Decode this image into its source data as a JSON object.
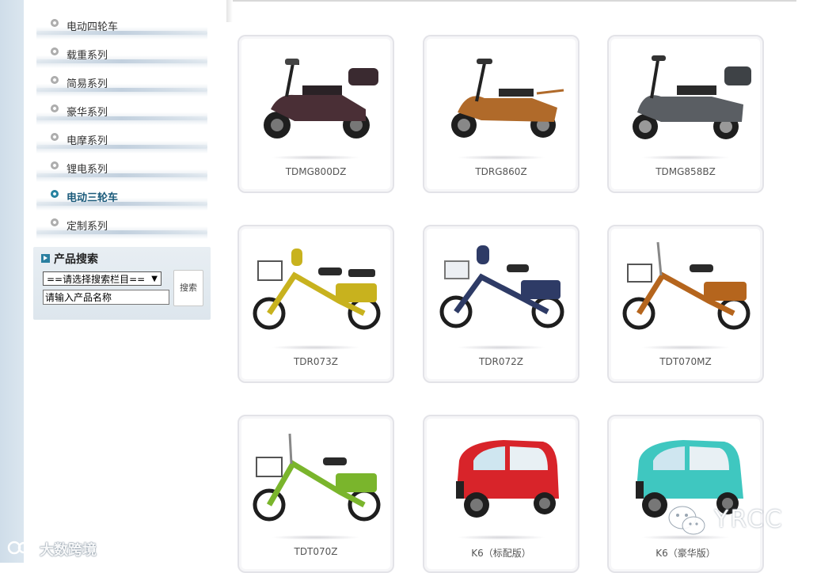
{
  "sidebar": {
    "categories": [
      {
        "label": "电动四轮车"
      },
      {
        "label": "载重系列"
      },
      {
        "label": "简易系列"
      },
      {
        "label": "豪华系列"
      },
      {
        "label": "电摩系列"
      },
      {
        "label": "锂电系列"
      },
      {
        "label": "电动三轮车"
      },
      {
        "label": "定制系列"
      }
    ]
  },
  "search": {
    "title": "产品搜索",
    "select_value": "==请选择搜索栏目==",
    "input_value": "请输入产品名称",
    "button_label": "搜索"
  },
  "products": [
    {
      "name": "TDMG800DZ",
      "color": "#4a2f36"
    },
    {
      "name": "TDRG860Z",
      "color": "#b06a2a"
    },
    {
      "name": "TDMG858BZ",
      "color": "#5a5e63"
    },
    {
      "name": "TDR073Z",
      "color": "#c8b21e"
    },
    {
      "name": "TDR072Z",
      "color": "#2e3b66"
    },
    {
      "name": "TDT070MZ",
      "color": "#b5651d"
    },
    {
      "name": "TDT070Z",
      "color": "#7ab52c"
    },
    {
      "name": "K6（标配版）",
      "color": "#d8242a"
    },
    {
      "name": "K6（豪华版）",
      "color": "#3fc7c0"
    }
  ],
  "watermarks": {
    "left": "大数跨境",
    "right": "YRCC"
  },
  "colors": {
    "accent": "#2a7fa0",
    "active_category": "#1a5a7a"
  }
}
